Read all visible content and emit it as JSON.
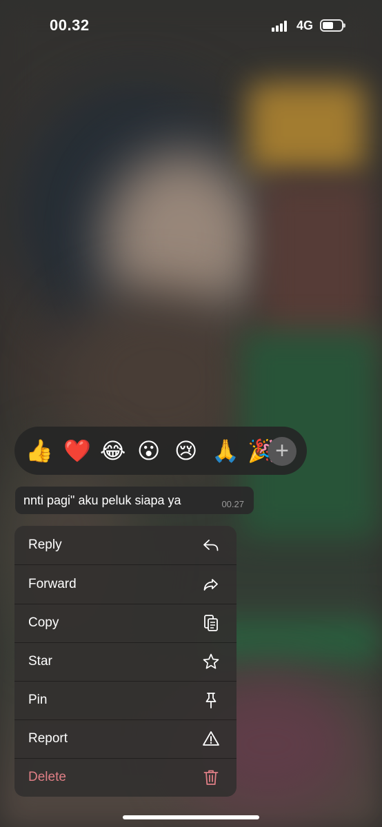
{
  "status_bar": {
    "time": "00.32",
    "network": "4G",
    "icons": [
      "signal-bars-icon",
      "battery-icon"
    ]
  },
  "reactions": {
    "items": [
      {
        "name": "thumbs-up-icon",
        "emoji": "👍"
      },
      {
        "name": "red-heart-icon",
        "emoji": "❤️"
      },
      {
        "name": "tears-of-joy-icon",
        "emoji": "😂"
      },
      {
        "name": "surprised-face-icon",
        "emoji": "😮"
      },
      {
        "name": "crying-face-icon",
        "emoji": "😢"
      },
      {
        "name": "folded-hands-icon",
        "emoji": "🙏"
      },
      {
        "name": "party-popper-icon",
        "emoji": "🎉"
      }
    ],
    "more_icon": "plus-icon"
  },
  "message": {
    "text": "nnti pagi\" aku peluk siapa ya",
    "time": "00.27"
  },
  "menu": {
    "items": [
      {
        "label": "Reply",
        "icon": "reply-icon"
      },
      {
        "label": "Forward",
        "icon": "forward-icon"
      },
      {
        "label": "Copy",
        "icon": "copy-icon"
      },
      {
        "label": "Star",
        "icon": "star-icon"
      },
      {
        "label": "Pin",
        "icon": "pin-icon"
      },
      {
        "label": "Report",
        "icon": "warning-icon"
      },
      {
        "label": "Delete",
        "icon": "trash-icon",
        "color": "#e07f86"
      }
    ]
  }
}
